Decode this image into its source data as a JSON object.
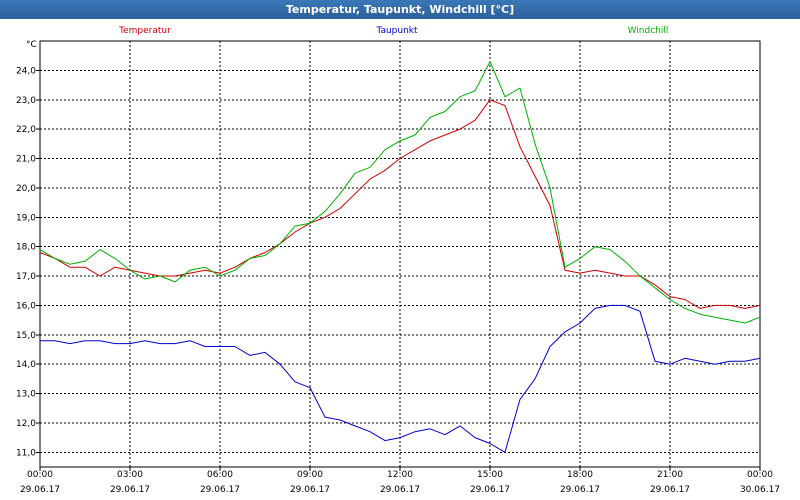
{
  "window": {
    "title": "Temperatur, Taupunkt, Windchill [°C]"
  },
  "colors": {
    "temperature": "#cc0000",
    "dewpoint": "#0000cc",
    "windchill": "#00b000",
    "grid": "#000000",
    "background": "#ffffff"
  },
  "chart_data": {
    "type": "line",
    "title": "Temperatur, Taupunkt, Windchill [°C]",
    "ylabel": "°C",
    "xlabel": "",
    "ylim": [
      10.5,
      25.0
    ],
    "xlim": [
      0,
      24
    ],
    "grid": true,
    "legend_position": "top",
    "y_ticks": [
      "11,0",
      "12,0",
      "13,0",
      "14,0",
      "15,0",
      "16,0",
      "17,0",
      "18,0",
      "19,0",
      "20,0",
      "21,0",
      "22,0",
      "23,0",
      "24,0"
    ],
    "y_tick_values": [
      11,
      12,
      13,
      14,
      15,
      16,
      17,
      18,
      19,
      20,
      21,
      22,
      23,
      24
    ],
    "x_tick_hours": [
      0,
      3,
      6,
      9,
      12,
      15,
      18,
      21,
      24
    ],
    "x_ticks_time": [
      "00:00",
      "03:00",
      "06:00",
      "09:00",
      "12:00",
      "15:00",
      "18:00",
      "21:00",
      "00:00"
    ],
    "x_ticks_date": [
      "29.06.17",
      "29.06.17",
      "29.06.17",
      "29.06.17",
      "29.06.17",
      "29.06.17",
      "29.06.17",
      "29.06.17",
      "30.06.17"
    ],
    "x": [
      0,
      0.5,
      1,
      1.5,
      2,
      2.5,
      3,
      3.5,
      4,
      4.5,
      5,
      5.5,
      6,
      6.5,
      7,
      7.5,
      8,
      8.5,
      9,
      9.5,
      10,
      10.5,
      11,
      11.5,
      12,
      12.5,
      13,
      13.5,
      14,
      14.5,
      15,
      15.5,
      16,
      16.5,
      17,
      17.5,
      18,
      18.5,
      19,
      19.5,
      20,
      20.5,
      21,
      21.5,
      22,
      22.5,
      23,
      23.5,
      24
    ],
    "series": [
      {
        "name": "Temperatur",
        "color": "#cc0000",
        "values": [
          17.8,
          17.6,
          17.3,
          17.3,
          17.0,
          17.3,
          17.2,
          17.1,
          17.0,
          17.0,
          17.1,
          17.2,
          17.1,
          17.3,
          17.6,
          17.8,
          18.1,
          18.5,
          18.8,
          19.0,
          19.3,
          19.8,
          20.3,
          20.6,
          21.0,
          21.3,
          21.6,
          21.8,
          22.0,
          22.3,
          23.0,
          22.8,
          21.4,
          20.4,
          19.4,
          17.2,
          17.1,
          17.2,
          17.1,
          17.0,
          17.0,
          16.7,
          16.3,
          16.2,
          15.9,
          16.0,
          16.0,
          15.9,
          16.0
        ]
      },
      {
        "name": "Taupunkt",
        "color": "#0000cc",
        "values": [
          14.8,
          14.8,
          14.7,
          14.8,
          14.8,
          14.7,
          14.7,
          14.8,
          14.7,
          14.7,
          14.8,
          14.6,
          14.6,
          14.6,
          14.3,
          14.4,
          14.0,
          13.4,
          13.2,
          12.2,
          12.1,
          11.9,
          11.7,
          11.4,
          11.5,
          11.7,
          11.8,
          11.6,
          11.9,
          11.5,
          11.3,
          11.0,
          12.8,
          13.5,
          14.6,
          15.1,
          15.4,
          15.9,
          16.0,
          16.0,
          15.8,
          14.1,
          14.0,
          14.2,
          14.1,
          14.0,
          14.1,
          14.1,
          14.2
        ]
      },
      {
        "name": "Windchill",
        "color": "#00b000",
        "values": [
          17.9,
          17.6,
          17.4,
          17.5,
          17.9,
          17.6,
          17.2,
          16.9,
          17.0,
          16.8,
          17.2,
          17.3,
          17.0,
          17.2,
          17.6,
          17.7,
          18.1,
          18.7,
          18.8,
          19.2,
          19.8,
          20.5,
          20.7,
          21.3,
          21.6,
          21.8,
          22.4,
          22.6,
          23.1,
          23.3,
          24.3,
          23.1,
          23.4,
          21.5,
          20.0,
          17.3,
          17.6,
          18.0,
          17.9,
          17.5,
          17.0,
          16.6,
          16.2,
          15.9,
          15.7,
          15.6,
          15.5,
          15.4,
          15.6
        ]
      }
    ]
  }
}
